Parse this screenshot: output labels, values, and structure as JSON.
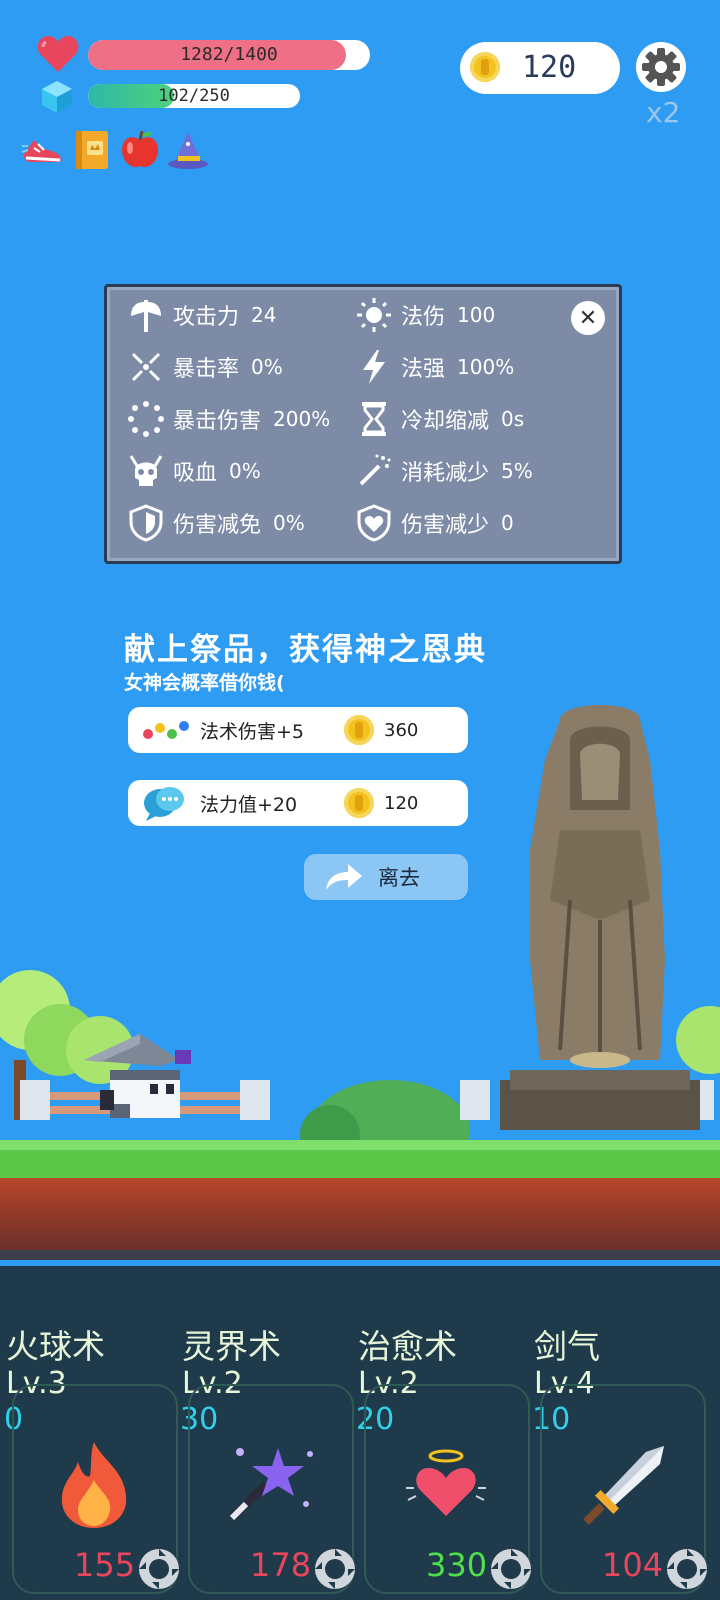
{
  "hud": {
    "hp_text": "1282/1400",
    "hp_ratio": 0.9157,
    "mp_text": "102/250",
    "mp_ratio": 0.408,
    "coins": "120",
    "speed": "x2",
    "items": [
      "shoe-icon",
      "book-icon",
      "apple-icon",
      "wizard-hat-icon"
    ]
  },
  "stats": [
    {
      "icon": "axe-icon",
      "label": "攻击力",
      "value": "24"
    },
    {
      "icon": "sun-icon",
      "label": "法伤",
      "value": "100"
    },
    {
      "icon": "crit-icon",
      "label": "暴击率",
      "value": "0%"
    },
    {
      "icon": "lightning-icon",
      "label": "法强",
      "value": "100%"
    },
    {
      "icon": "crit-damage-icon",
      "label": "暴击伤害",
      "value": "200%"
    },
    {
      "icon": "hourglass-icon",
      "label": "冷却缩减",
      "value": "0s"
    },
    {
      "icon": "skull-icon",
      "label": "吸血",
      "value": "0%"
    },
    {
      "icon": "magic-wand-icon",
      "label": "消耗减少",
      "value": "5%"
    },
    {
      "icon": "shield-icon",
      "label": "伤害减免",
      "value": "0%"
    },
    {
      "icon": "heart-shield-icon",
      "label": "伤害减少",
      "value": "0"
    }
  ],
  "offering": {
    "title": "献上祭品，获得神之恩典",
    "subtitle": "女神会概率借你钱(",
    "options": [
      {
        "icon": "dots-icon",
        "label": "法术伤害+5",
        "price": "360"
      },
      {
        "icon": "chat-bubble-icon",
        "label": "法力值+20",
        "price": "120"
      }
    ],
    "leave_label": "离去"
  },
  "skills": [
    {
      "name": "火球术",
      "level": "Lv.3",
      "cost": "0",
      "count": "155",
      "icon": "fire-icon",
      "count_color": "#e8465c"
    },
    {
      "name": "灵界术",
      "level": "Lv.2",
      "cost": "30",
      "count": "178",
      "icon": "star-wand-icon",
      "count_color": "#e8465c"
    },
    {
      "name": "治愈术",
      "level": "Lv.2",
      "cost": "20",
      "count": "330",
      "icon": "angel-heart-icon",
      "count_color": "#4ee04a"
    },
    {
      "name": "剑气",
      "level": "Lv.4",
      "cost": "10",
      "count": "104",
      "icon": "sword-icon",
      "count_color": "#e8465c"
    }
  ]
}
